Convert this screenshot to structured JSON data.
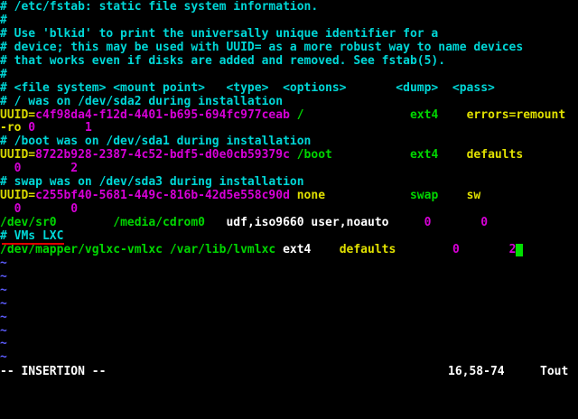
{
  "colors": {
    "background": "#000000",
    "comment": "#00d7d7",
    "keyword": "#00d700",
    "constant": "#d700d7",
    "identifier": "#d7d700",
    "statement": "#e0e000",
    "text": "#ffffff",
    "tilde": "#5c5cff",
    "cursor": "#00e000",
    "highlight_underline": "#e00000"
  },
  "lines": [
    [
      {
        "t": "# /etc/fstab: static file system information.",
        "c": "comment"
      }
    ],
    [
      {
        "t": "#",
        "c": "comment"
      }
    ],
    [
      {
        "t": "# Use 'blkid' to print the universally unique identifier for a",
        "c": "comment"
      }
    ],
    [
      {
        "t": "# device; this may be used with UUID= as a more robust way to name devices",
        "c": "comment"
      }
    ],
    [
      {
        "t": "# that works even if disks are added and removed. See fstab(5).",
        "c": "comment"
      }
    ],
    [
      {
        "t": "#",
        "c": "comment"
      }
    ],
    [
      {
        "t": "# <file system> <mount point>   <type>  <options>       <dump>  <pass>",
        "c": "comment"
      }
    ],
    [
      {
        "t": "# / was on /dev/sda2 during installation",
        "c": "comment"
      }
    ],
    [
      {
        "t": "UUID=",
        "c": "identifier"
      },
      {
        "t": "c4f98da4-f12d-4401-b695-694fc977ceab",
        "c": "constant"
      },
      {
        "t": " /",
        "c": "keyword"
      },
      {
        "t": "               ",
        "c": "text"
      },
      {
        "t": "ext4",
        "c": "keyword"
      },
      {
        "t": "    ",
        "c": "text"
      },
      {
        "t": "errors=remount",
        "c": "statement"
      }
    ],
    [
      {
        "t": "-ro",
        "c": "statement"
      },
      {
        "t": " 0       ",
        "c": "constant"
      },
      {
        "t": "1",
        "c": "constant"
      }
    ],
    [
      {
        "t": "# /boot was on /dev/sda1 during installation",
        "c": "comment"
      }
    ],
    [
      {
        "t": "UUID=",
        "c": "identifier"
      },
      {
        "t": "8722b928-2387-4c52-bdf5-d0e0cb59379c",
        "c": "constant"
      },
      {
        "t": " /boot",
        "c": "keyword"
      },
      {
        "t": "           ",
        "c": "text"
      },
      {
        "t": "ext4",
        "c": "keyword"
      },
      {
        "t": "    ",
        "c": "text"
      },
      {
        "t": "defaults",
        "c": "statement"
      }
    ],
    [
      {
        "t": "  0       ",
        "c": "constant"
      },
      {
        "t": "2",
        "c": "constant"
      }
    ],
    [
      {
        "t": "# swap was on /dev/sda3 during installation",
        "c": "comment"
      }
    ],
    [
      {
        "t": "UUID=",
        "c": "identifier"
      },
      {
        "t": "c255bf40-5681-449c-816b-42d5e558c90d",
        "c": "constant"
      },
      {
        "t": " none",
        "c": "statement"
      },
      {
        "t": "            ",
        "c": "text"
      },
      {
        "t": "swap",
        "c": "keyword"
      },
      {
        "t": "    ",
        "c": "text"
      },
      {
        "t": "sw",
        "c": "statement"
      }
    ],
    [
      {
        "t": "  0       ",
        "c": "constant"
      },
      {
        "t": "0",
        "c": "constant"
      }
    ],
    [
      {
        "t": "/dev/sr0",
        "c": "keyword"
      },
      {
        "t": "        ",
        "c": "text"
      },
      {
        "t": "/media/cdrom0",
        "c": "keyword"
      },
      {
        "t": "   ",
        "c": "text"
      },
      {
        "t": "udf,iso9660",
        "c": "text"
      },
      {
        "t": " ",
        "c": "text"
      },
      {
        "t": "user,noauto",
        "c": "text"
      },
      {
        "t": "     ",
        "c": "text"
      },
      {
        "t": "0",
        "c": "constant"
      },
      {
        "t": "       ",
        "c": "text"
      },
      {
        "t": "0",
        "c": "constant"
      }
    ],
    [
      {
        "t": "# VMs LXC",
        "c": "comment"
      }
    ],
    [
      {
        "t": "/dev/mapper/vglxc-vmlxc",
        "c": "keyword"
      },
      {
        "t": " ",
        "c": "text"
      },
      {
        "t": "/var/lib/lvmlxc",
        "c": "keyword"
      },
      {
        "t": " ",
        "c": "text"
      },
      {
        "t": "ext4",
        "c": "text"
      },
      {
        "t": "    ",
        "c": "text"
      },
      {
        "t": "defaults",
        "c": "statement"
      },
      {
        "t": "        ",
        "c": "text"
      },
      {
        "t": "0",
        "c": "constant"
      },
      {
        "t": "       ",
        "c": "text"
      },
      {
        "t": "2",
        "c": "constant"
      }
    ],
    [
      {
        "t": "~",
        "c": "tilde"
      }
    ],
    [
      {
        "t": "~",
        "c": "tilde"
      }
    ],
    [
      {
        "t": "~",
        "c": "tilde"
      }
    ],
    [
      {
        "t": "~",
        "c": "tilde"
      }
    ],
    [
      {
        "t": "~",
        "c": "tilde"
      }
    ],
    [
      {
        "t": "~",
        "c": "tilde"
      }
    ],
    [
      {
        "t": "~",
        "c": "tilde"
      }
    ],
    [
      {
        "t": "~",
        "c": "tilde"
      }
    ]
  ],
  "cursor_line": 18,
  "underline_line": 17,
  "status": {
    "mode": "-- INSERTION --",
    "position": "16,58-74",
    "scroll": "Tout"
  }
}
